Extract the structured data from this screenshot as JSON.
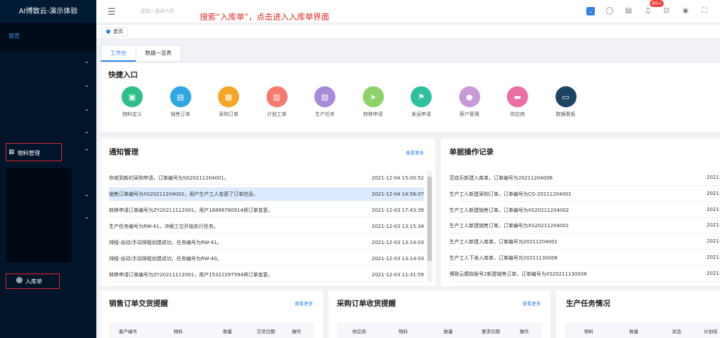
{
  "app_title": "AI博致云-演示体验",
  "sidebar": {
    "home": "首页",
    "material_menu": "物料管理",
    "inbound_item": "入库单"
  },
  "topbar": {
    "search_placeholder": "请输入搜索内容",
    "annotation": "搜索“入库单”，点击进入入库单界面",
    "badge": "99+"
  },
  "tabs": {
    "home_tab": "首页",
    "subtabs": [
      "工作台",
      "数据一览表"
    ]
  },
  "quick": {
    "title": "快捷入口",
    "items": [
      {
        "label": "物料定义",
        "color": "#2fc08a",
        "icon": "▣"
      },
      {
        "label": "销售订单",
        "color": "#2fa7e0",
        "icon": "▤"
      },
      {
        "label": "采购订单",
        "color": "#f5a623",
        "icon": "▦"
      },
      {
        "label": "计划工单",
        "color": "#f47b6e",
        "icon": "▥"
      },
      {
        "label": "生产任务",
        "color": "#a98ad8",
        "icon": "▨"
      },
      {
        "label": "转移申请",
        "color": "#8fd26a",
        "icon": "➤"
      },
      {
        "label": "发运申请",
        "color": "#2fc0a0",
        "icon": "⚑"
      },
      {
        "label": "客户管理",
        "color": "#c99ad8",
        "icon": "●"
      },
      {
        "label": "供应商",
        "color": "#ec6fa2",
        "icon": "▬"
      },
      {
        "label": "数据看板",
        "color": "#1e4464",
        "icon": "▭"
      }
    ]
  },
  "notice": {
    "title": "通知管理",
    "more": "查看更多",
    "rows": [
      {
        "text": "你收到新的采购申请，订单编号为SG20211204001。",
        "time": "2021-12-04 15:00:52"
      },
      {
        "text": "销售订单编号为XS20211204002，用户生产工人变更了订单信息。",
        "time": "2021-12-04 14:56:07"
      },
      {
        "text": "转移申请订单编号为ZY20211112001，用户18898780914将订单变更。",
        "time": "2021-12-03 17:43:39"
      },
      {
        "text": "生产任务编号为RW-41，冲刷工位开始执行任务。",
        "time": "2021-12-03 13:15:34"
      },
      {
        "text": "排程-自动/手动排程创建成功，任务编号为RW-41。",
        "time": "2021-12-03 13:14:03"
      },
      {
        "text": "排程-自动/手动排程创建成功，任务编号为RW-40。",
        "time": "2021-12-03 13:14:03"
      },
      {
        "text": "转移申请订单编号为ZY20211112001，用户15322297594将订单变更。",
        "time": "2021-12-03 11:31:59"
      }
    ]
  },
  "records": {
    "title": "单据操作记录",
    "year_cut": "2021-",
    "rows": [
      "范佳乐新建入库单，订单编号为20211204006",
      "生产工人新建采购订单，订单编号为CG-20211204001",
      "生产工人新建销售订单，订单编号为XS20211204002",
      "生产工人新建销售订单，订单编号为XS20211204001",
      "生产工人新建入库单，订单编号为20211204001",
      "生产工人下发入库单，订单编号为20211130008",
      "博致云模拟账号2新建销售订单，订单编号为XS20211130036"
    ]
  },
  "sales_reminder": {
    "title": "销售订单交货提醒",
    "more": "查看更多",
    "headers": [
      "客户编号",
      "物料",
      "数量",
      "交货日期",
      "操作"
    ]
  },
  "purchase_reminder": {
    "title": "采购订单收货提醒",
    "more": "查看更多",
    "headers": [
      "供应商",
      "物料",
      "数量",
      "要求日期",
      "操作"
    ]
  },
  "production": {
    "title": "生产任务情况",
    "headers": [
      "物料",
      "数量",
      "状态",
      "计划结"
    ]
  }
}
